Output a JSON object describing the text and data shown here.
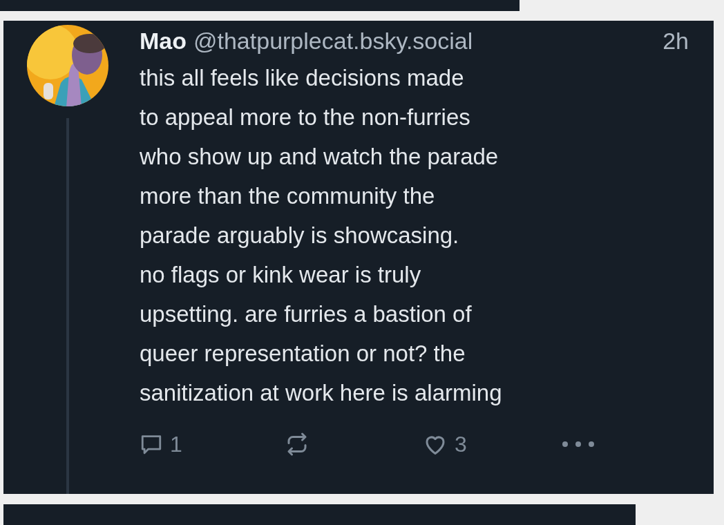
{
  "post": {
    "author": "Mao",
    "handle": "@thatpurplecat.bsky.social",
    "time": "2h",
    "text": "this all feels like decisions made\nto appeal more to the non-furries\nwho show up and watch the parade\nmore than the community the\nparade arguably is showcasing.\nno flags or kink wear is truly\nupsetting. are furries a bastion of\nqueer representation or not? the\nsanitization at work here is alarming",
    "replies": "1",
    "likes": "3"
  }
}
